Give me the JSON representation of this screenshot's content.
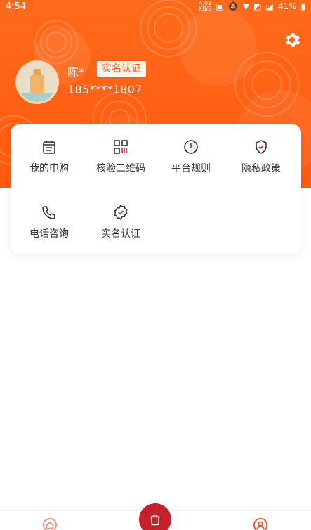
{
  "status_bar": {
    "time": "4:54",
    "network_speed": "4.03",
    "network_unit": "KB/S",
    "battery": "41%"
  },
  "profile": {
    "name": "陈*",
    "verify_badge": "实名认证",
    "phone": "185****1807"
  },
  "menu": {
    "items": [
      {
        "label": "我的申购",
        "icon": "calendar-icon"
      },
      {
        "label": "核验二维码",
        "icon": "qrcode-icon"
      },
      {
        "label": "平台规则",
        "icon": "alert-circle-icon"
      },
      {
        "label": "隐私政策",
        "icon": "shield-check-icon"
      },
      {
        "label": "电话咨询",
        "icon": "phone-icon"
      },
      {
        "label": "实名认证",
        "icon": "badge-check-icon"
      }
    ]
  },
  "colors": {
    "brand": "#ff5a10",
    "tab_accent": "#c6202a",
    "icon": "#333333"
  },
  "tabbar": {
    "items": [
      "home-icon",
      "shop-bag-icon",
      "user-icon"
    ]
  }
}
